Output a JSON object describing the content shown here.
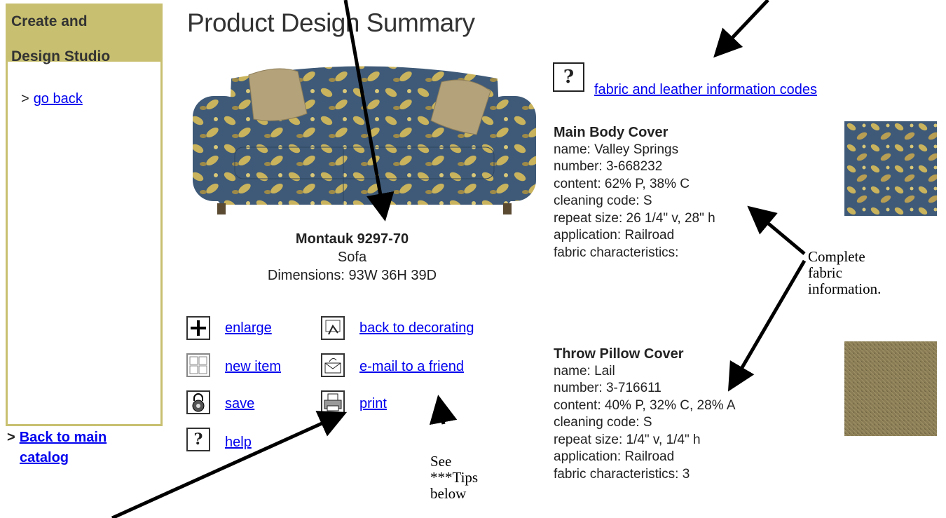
{
  "sidebar": {
    "heading": "Create and Design Studio",
    "heading_line1": "Create and",
    "heading_line2": "Design Studio",
    "go_back": "go back",
    "back_main_line1": "Back to main",
    "back_main_line2": "catalog",
    "arrow": ">"
  },
  "page_title": "Product Design Summary",
  "product": {
    "name": "Montauk 9297-70",
    "type": "Sofa",
    "dimensions": "Dimensions:  93W 36H 39D"
  },
  "actions": {
    "enlarge": "enlarge",
    "new_item": "new item",
    "save": "save",
    "help": "help",
    "back_to_decorating": "back to decorating",
    "email_friend": "e-mail to a friend",
    "print": "print"
  },
  "fabric_codes": {
    "icon_text": "?",
    "link": "fabric and leather information codes"
  },
  "main_body": {
    "heading": "Main Body Cover",
    "name": "name:  Valley Springs",
    "number": "number:  3-668232",
    "content": "content:  62% P, 38% C",
    "cleaning": "cleaning code:  S",
    "repeat": "repeat size:  26 1/4\" v, 28\" h",
    "application": "application:  Railroad",
    "characteristics": "fabric characteristics:"
  },
  "pillow": {
    "heading": "Throw Pillow Cover",
    "name": "name:  Lail",
    "number": "number:  3-716611",
    "content": "content:  40% P, 32% C, 28% A",
    "cleaning": "cleaning code:  S",
    "repeat": "repeat size:  1/4\" v, 1/4\" h",
    "application": "application:  Railroad",
    "characteristics": "fabric characteristics:  3"
  },
  "annotations": {
    "complete_line1": "Complete",
    "complete_line2": "fabric",
    "complete_line3": "information.",
    "tips_line1": "See",
    "tips_line2": "***Tips",
    "tips_line3": "below"
  },
  "colors": {
    "sidebar_accent": "#c8c070",
    "link": "#0000ee",
    "fabric_blue": "#3f5a78",
    "fabric_yellow": "#c9b35c",
    "pillow_tan": "#8a7d55"
  }
}
